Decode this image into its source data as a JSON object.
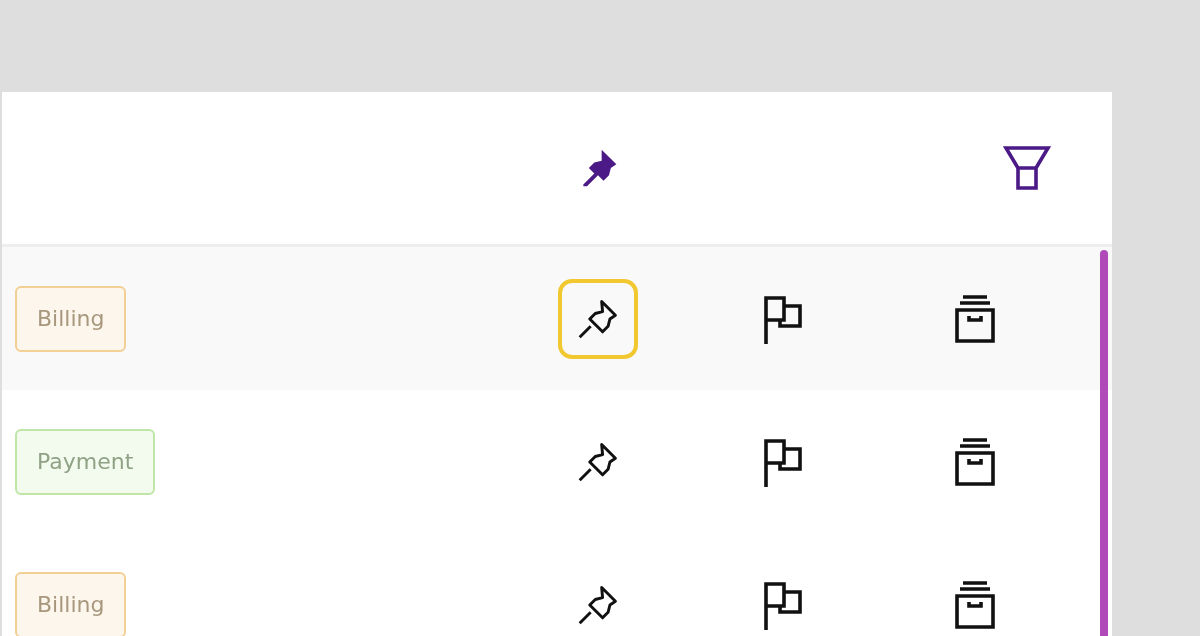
{
  "rows": [
    {
      "tag": {
        "label": "Billing",
        "color": "#f2cf94"
      },
      "highlighted": true,
      "pin_focused": true
    },
    {
      "tag": {
        "label": "Payment",
        "color": "#bfe6a6"
      },
      "highlighted": false,
      "pin_focused": false
    },
    {
      "tag": {
        "label": "Billing",
        "color": "#f2cf94"
      },
      "highlighted": false,
      "pin_focused": false
    }
  ]
}
